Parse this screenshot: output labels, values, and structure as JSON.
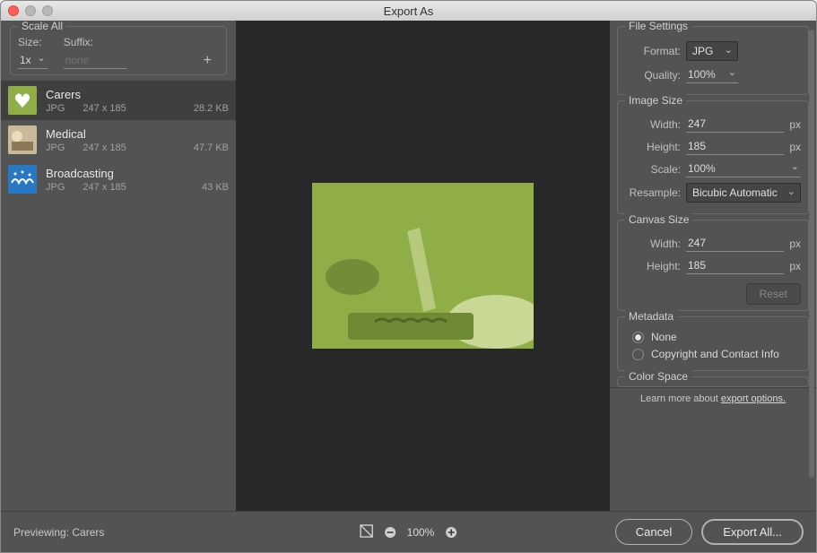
{
  "window": {
    "title": "Export As"
  },
  "scale_all": {
    "legend": "Scale All",
    "size_label": "Size:",
    "suffix_label": "Suffix:",
    "size_value": "1x",
    "suffix_placeholder": "none"
  },
  "assets": [
    {
      "name": "Carers",
      "format": "JPG",
      "dims": "247 x 185",
      "filesize": "28.2 KB",
      "selected": true
    },
    {
      "name": "Medical",
      "format": "JPG",
      "dims": "247 x 185",
      "filesize": "47.7 KB",
      "selected": false
    },
    {
      "name": "Broadcasting",
      "format": "JPG",
      "dims": "247 x 185",
      "filesize": "43 KB",
      "selected": false
    }
  ],
  "file_settings": {
    "legend": "File Settings",
    "format_label": "Format:",
    "format_value": "JPG",
    "quality_label": "Quality:",
    "quality_value": "100%"
  },
  "image_size": {
    "legend": "Image Size",
    "width_label": "Width:",
    "width_value": "247",
    "width_unit": "px",
    "height_label": "Height:",
    "height_value": "185",
    "height_unit": "px",
    "scale_label": "Scale:",
    "scale_value": "100%",
    "resample_label": "Resample:",
    "resample_value": "Bicubic Automatic"
  },
  "canvas_size": {
    "legend": "Canvas Size",
    "width_label": "Width:",
    "width_value": "247",
    "width_unit": "px",
    "height_label": "Height:",
    "height_value": "185",
    "height_unit": "px",
    "reset_label": "Reset"
  },
  "metadata": {
    "legend": "Metadata",
    "none_label": "None",
    "contact_label": "Copyright and Contact Info",
    "selected": "none"
  },
  "color_space": {
    "legend": "Color Space"
  },
  "learn_more": {
    "text": "Learn more about ",
    "link": "export options."
  },
  "footer": {
    "previewing_label": "Previewing:",
    "previewing_value": "Carers",
    "zoom_value": "100%",
    "cancel": "Cancel",
    "export": "Export All..."
  }
}
